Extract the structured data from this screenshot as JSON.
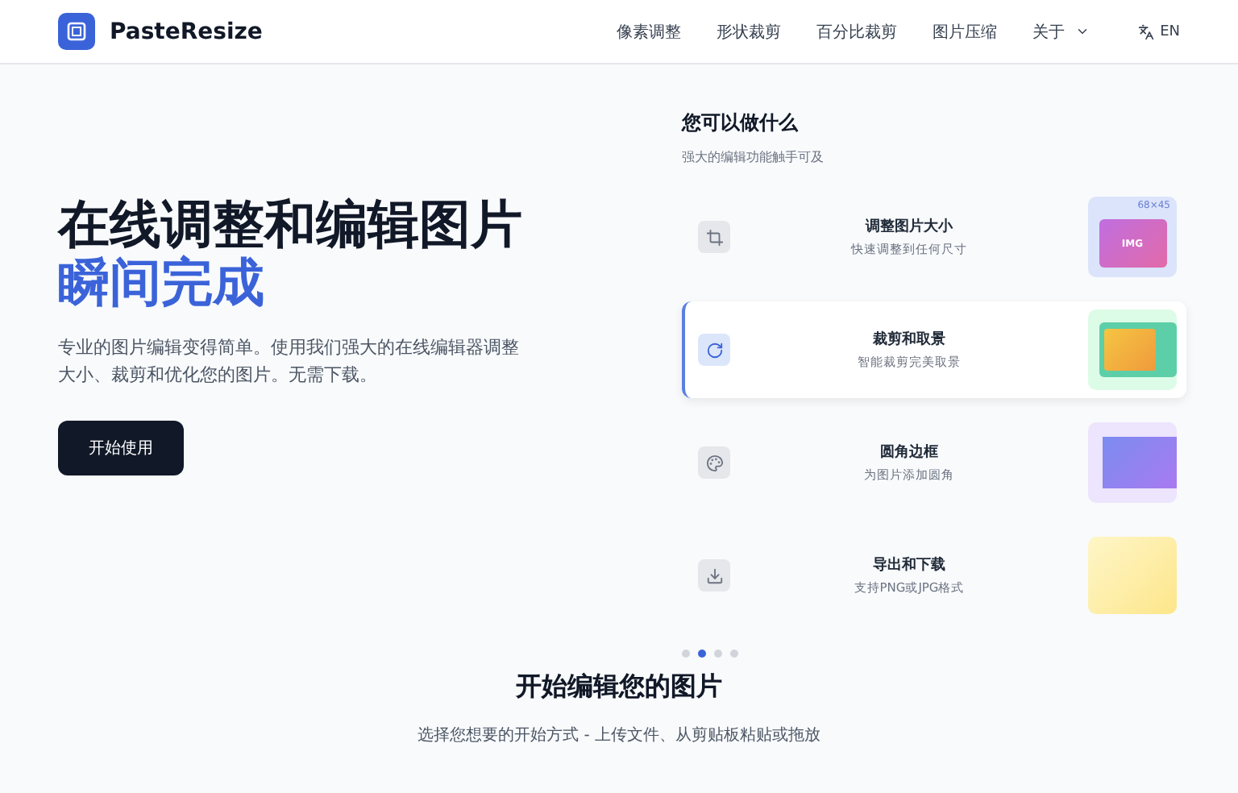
{
  "header": {
    "brand": "PasteResize",
    "nav": [
      {
        "label": "像素调整",
        "has_menu": false
      },
      {
        "label": "形状裁剪",
        "has_menu": false
      },
      {
        "label": "百分比裁剪",
        "has_menu": false
      },
      {
        "label": "图片压缩",
        "has_menu": false
      },
      {
        "label": "关于",
        "has_menu": true
      }
    ],
    "language": "EN"
  },
  "hero": {
    "title": "在线调整和编辑图片",
    "title_accent": "瞬间完成",
    "description": "专业的图片编辑变得简单。使用我们强大的在线编辑器调整大小、裁剪和优化您的图片。无需下载。",
    "cta": "开始使用"
  },
  "features": {
    "title": "您可以做什么",
    "subtitle": "强大的编辑功能触手可及",
    "items": [
      {
        "kind": "resize",
        "title": "调整图片大小",
        "description": "快速调整到任何尺寸",
        "selected": false,
        "preview_size": "68×45",
        "preview_label": "IMG"
      },
      {
        "kind": "crop",
        "title": "裁剪和取景",
        "description": "智能裁剪完美取景",
        "selected": true
      },
      {
        "kind": "rounded",
        "title": "圆角边框",
        "description": "为图片添加圆角",
        "selected": false
      },
      {
        "kind": "export",
        "title": "导出和下载",
        "description": "支持PNG或JPG格式",
        "selected": false
      }
    ],
    "dots": [
      {
        "selected": false
      },
      {
        "selected": true
      },
      {
        "selected": false
      },
      {
        "selected": false
      }
    ]
  },
  "start": {
    "title": "开始编辑您的图片",
    "subtitle": "选择您想要的开始方式 - 上传文件、从剪贴板粘贴或拖放"
  }
}
